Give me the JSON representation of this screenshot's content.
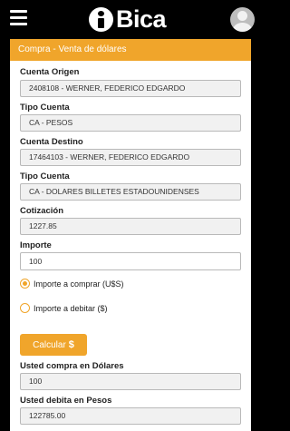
{
  "app": {
    "logo_text": "Bica"
  },
  "card": {
    "title": "Compra - Venta de dólares"
  },
  "form": {
    "cuenta_origen": {
      "label": "Cuenta Origen",
      "value": "2408108 - WERNER, FEDERICO EDGARDO"
    },
    "tipo_cuenta_origen": {
      "label": "Tipo Cuenta",
      "value": "CA - PESOS"
    },
    "cuenta_destino": {
      "label": "Cuenta Destino",
      "value": "17464103 - WERNER, FEDERICO EDGARDO"
    },
    "tipo_cuenta_destino": {
      "label": "Tipo Cuenta",
      "value": "CA - DOLARES BILLETES ESTADOUNIDENSES"
    },
    "cotizacion": {
      "label": "Cotización",
      "value": "1227.85"
    },
    "importe": {
      "label": "Importe",
      "value": "100"
    },
    "radio_comprar": {
      "label": "Importe a comprar (U$S)",
      "selected": true
    },
    "radio_debitar": {
      "label": "Importe a debitar ($)",
      "selected": false
    },
    "calcular": {
      "label": "Calcular",
      "icon": "$"
    },
    "compra_dolares": {
      "label": "Usted compra en Dólares",
      "value": "100"
    },
    "debita_pesos": {
      "label": "Usted debita en Pesos",
      "value": "122785.00"
    }
  },
  "colors": {
    "accent": "#f0a52b",
    "topbar": "#000000"
  }
}
